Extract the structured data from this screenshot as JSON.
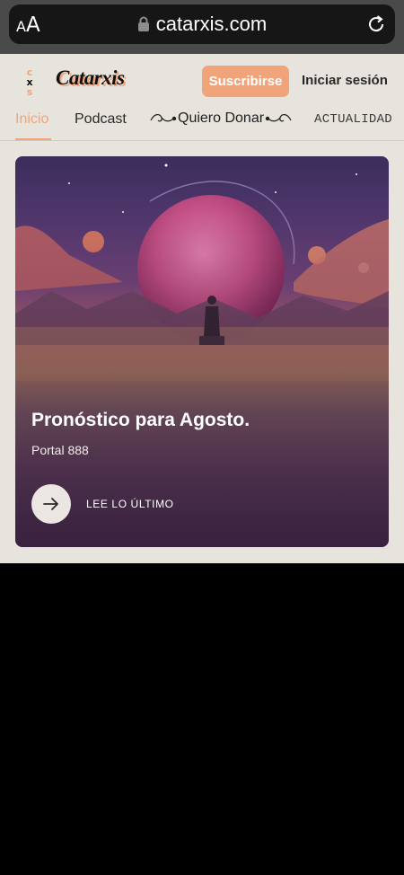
{
  "browser": {
    "text_size_small": "A",
    "text_size_big": "A",
    "url": "catarxis.com"
  },
  "header": {
    "brand": "Catarxis",
    "subscribe_label": "Suscribirse",
    "login_label": "Iniciar sesión"
  },
  "nav": {
    "items": [
      {
        "label": "Inicio",
        "active": true
      },
      {
        "label": "Podcast",
        "active": false
      },
      {
        "label": "Quiero Donar",
        "active": false
      },
      {
        "label": "ACTUALIDAD",
        "active": false
      }
    ]
  },
  "hero": {
    "title": "Pronóstico para Agosto.",
    "subtitle": "Portal 888",
    "cta_label": "LEE LO ÚLTIMO"
  },
  "colors": {
    "accent": "#f1a47a",
    "page_bg": "#e7e3dd"
  }
}
